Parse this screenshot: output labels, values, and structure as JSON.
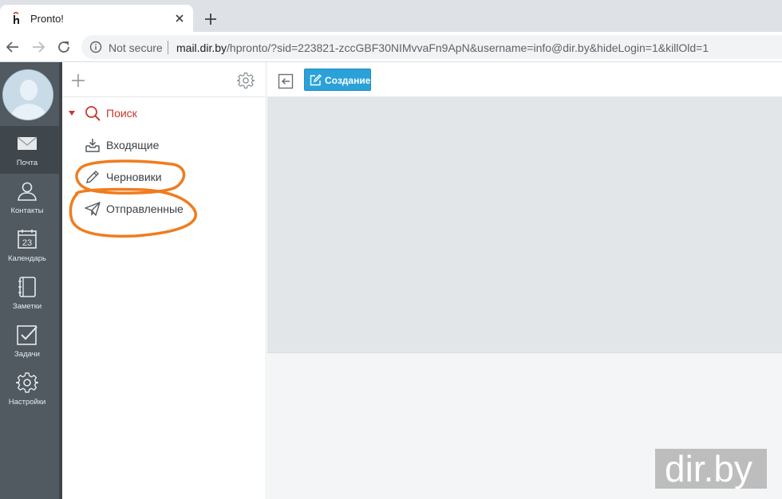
{
  "browser": {
    "tab_title": "Pronto!",
    "security_label": "Not secure",
    "url_host": "mail.dir.by",
    "url_rest": "/hpronto/?sid=223821-zccGBF30NIMvvaFn9ApN&username=info@dir.by&hideLogin=1&killOld=1"
  },
  "leftnav": {
    "items": [
      {
        "label": "Почта",
        "icon": "envelope-icon"
      },
      {
        "label": "Контакты",
        "icon": "contacts-icon"
      },
      {
        "label": "Календарь",
        "icon": "calendar-icon",
        "date": "23"
      },
      {
        "label": "Заметки",
        "icon": "notes-icon"
      },
      {
        "label": "Задачи",
        "icon": "tasks-icon"
      },
      {
        "label": "Настройки",
        "icon": "settings-icon"
      }
    ]
  },
  "folders": {
    "search_label": "Поиск",
    "items": [
      {
        "label": "Входящие",
        "icon": "inbox-icon"
      },
      {
        "label": "Черновики",
        "icon": "pencil-icon"
      },
      {
        "label": "Отправленные",
        "icon": "paper-plane-icon"
      }
    ]
  },
  "main": {
    "create_label": "Создание"
  },
  "watermark": {
    "text": "dir.by"
  },
  "colors": {
    "accent": "#2aa2d9",
    "sidebar": "#515a61",
    "search_red": "#c8372d",
    "annotation": "#f07c1f"
  }
}
